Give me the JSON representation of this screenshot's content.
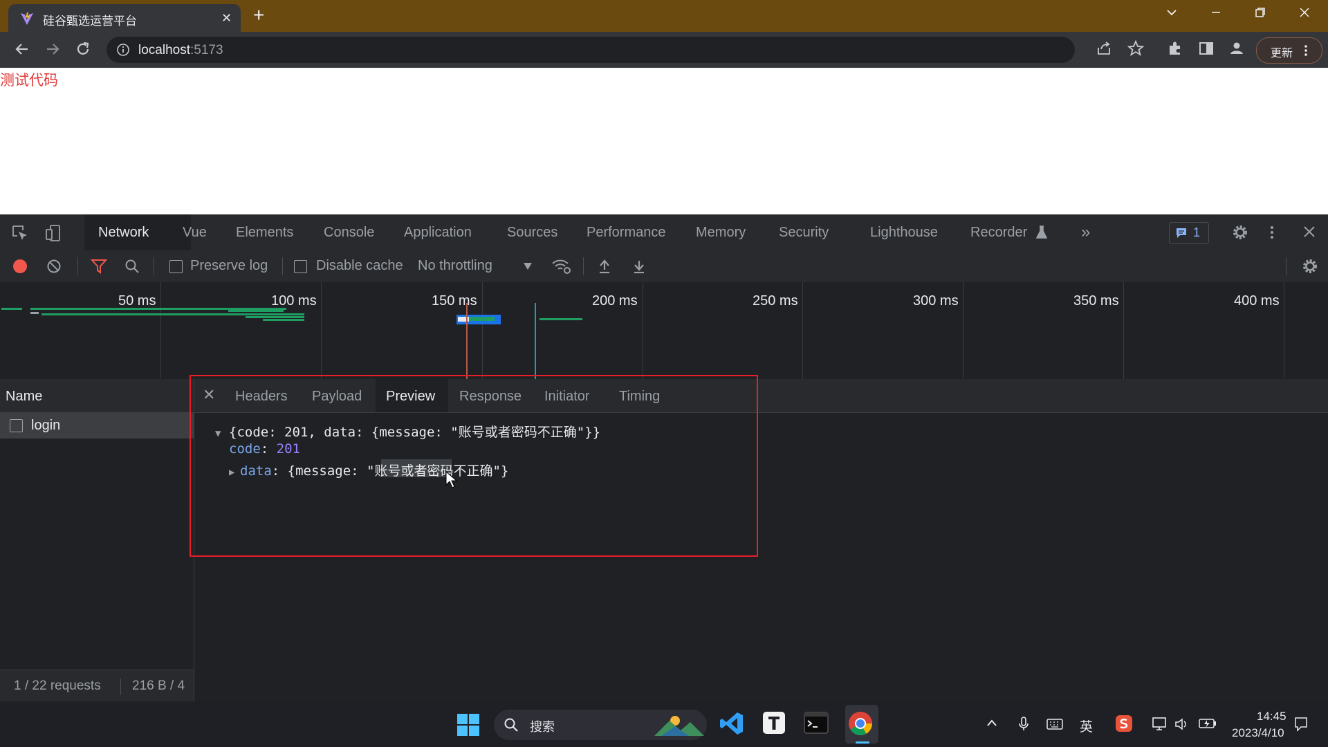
{
  "browser": {
    "tab_title": "硅谷甄选运营平台",
    "tab_close": "✕",
    "new_tab": "+",
    "url_host": "localhost",
    "url_port": ":5173",
    "update_label": "更新"
  },
  "page": {
    "text": "测试代码"
  },
  "devtools": {
    "tabs": [
      "Network",
      "Vue",
      "Elements",
      "Console",
      "Application",
      "Sources",
      "Performance",
      "Memory",
      "Security",
      "Lighthouse",
      "Recorder"
    ],
    "active_tab": "Network",
    "more_tabs": "»",
    "issues_count": "1",
    "toolbar": {
      "preserve_log": "Preserve log",
      "disable_cache": "Disable cache",
      "throttling": "No throttling"
    },
    "timeline_ticks": [
      "50 ms",
      "100 ms",
      "150 ms",
      "200 ms",
      "250 ms",
      "300 ms",
      "350 ms",
      "400 ms"
    ],
    "request_list": {
      "header": "Name",
      "rows": [
        "login"
      ],
      "status_requests": "1 / 22 requests",
      "status_size": "216 B / 4"
    },
    "detail": {
      "close": "✕",
      "tabs": [
        "Headers",
        "Payload",
        "Preview",
        "Response",
        "Initiator",
        "Timing"
      ],
      "active_tab": "Preview",
      "preview": {
        "summary": "{code: 201, data: {message: \"账号或者密码不正确\"}}",
        "code_key": "code",
        "code_value": "201",
        "data_key": "data",
        "data_value": "{message: \"账号或者密码不正确\"}"
      }
    }
  },
  "taskbar": {
    "search_label": "搜索",
    "ime": "英",
    "time": "14:45",
    "date": "2023/4/10"
  },
  "colors": {
    "tabbar": "#6b4a10",
    "devtools_bg": "#202124",
    "highlight_box": "#e81e2a",
    "record": "#f1574c"
  }
}
